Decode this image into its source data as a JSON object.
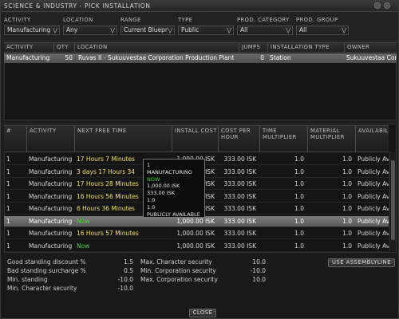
{
  "window": {
    "title": "SCIENCE & INDUSTRY - PICK INSTALLATION"
  },
  "filters": {
    "activity": {
      "label": "ACTIVITY",
      "value": "Manufacturing"
    },
    "location": {
      "label": "LOCATION",
      "value": "Any"
    },
    "range": {
      "label": "RANGE",
      "value": "Current Bluepr"
    },
    "type": {
      "label": "TYPE",
      "value": "Public"
    },
    "prod_category": {
      "label": "PROD. CATEGORY",
      "value": "All"
    },
    "prod_group": {
      "label": "PROD. GROUP",
      "value": "All"
    }
  },
  "locations_table": {
    "headers": [
      "ACTIVITY",
      "QTY",
      "LOCATION",
      "JUMPS",
      "INSTALLATION TYPE",
      "OWNER"
    ],
    "rows": [
      [
        "Manufacturing",
        "50",
        "Ruvas II - Sukuuvestaa Corporation Production Plant",
        "0",
        "Station",
        "Sukuuvestaa Corp"
      ]
    ]
  },
  "lines_table": {
    "headers": [
      "#",
      "ACTIVITY",
      "NEXT FREE TIME",
      "INSTALL COST",
      "COST PER HOUR",
      "TIME MULTIPLIER",
      "MATERIAL MULTIPLIER",
      "AVAILABILITY"
    ],
    "rows": [
      [
        "1",
        "Manufacturing",
        "17 Hours 7 Minutes",
        "1,000.00 ISK",
        "333.00 ISK",
        "1.0",
        "1.0",
        "Publicly Ava"
      ],
      [
        "1",
        "Manufacturing",
        "3 days 17 Hours 34",
        "1,000.00 ISK",
        "333.00 ISK",
        "1.0",
        "1.0",
        "Publicly Ava"
      ],
      [
        "1",
        "Manufacturing",
        "17 Hours 28 Minutes",
        "1,000.00 ISK",
        "333.00 ISK",
        "1.0",
        "1.0",
        "Publicly Ava"
      ],
      [
        "1",
        "Manufacturing",
        "16 Hours 56 Minutes",
        "1,000.00 ISK",
        "333.00 ISK",
        "1.0",
        "1.0",
        "Publicly Ava"
      ],
      [
        "1",
        "Manufacturing",
        "6 Hours 36 Minutes",
        "1,000.00 ISK",
        "333.00 ISK",
        "1.0",
        "1.0",
        "Publicly Ava"
      ],
      [
        "1",
        "Manufacturing",
        "Now",
        "1,000.00 ISK",
        "333.00 ISK",
        "1.0",
        "1.0",
        "Publicly Ava"
      ],
      [
        "1",
        "Manufacturing",
        "16 Hours 57 Minutes",
        "1,000.00 ISK",
        "333.00 ISK",
        "1.0",
        "1.0",
        "Publicly Ava"
      ],
      [
        "1",
        "Manufacturing",
        "Now",
        "1,000.00 ISK",
        "333.00 ISK",
        "1.0",
        "1.0",
        "Publicly Ava"
      ]
    ]
  },
  "tooltip": {
    "lines": [
      "1",
      "MANUFACTURING",
      "NOW",
      "1,000.00 ISK",
      "333.00 ISK",
      "1.0",
      "1.0",
      "PUBLICLY AVAILABLE"
    ]
  },
  "standings_left": [
    {
      "label": "Good standing discount %",
      "value": "1.5"
    },
    {
      "label": "Bad standing surcharge %",
      "value": "0.5"
    },
    {
      "label": "Min. standing",
      "value": "-10.0"
    },
    {
      "label": "Min. Character security",
      "value": "-10.0"
    }
  ],
  "standings_right": [
    {
      "label": "Max. Character security",
      "value": "10.0"
    },
    {
      "label": "Min. Corporation security",
      "value": "-10.0"
    },
    {
      "label": "Max. Corporation security",
      "value": "10.0"
    }
  ],
  "buttons": {
    "use_assembly_line": "USE ASSEMBLYLINE",
    "close": "CLOSE"
  },
  "colors": {
    "highlight_time": "#f0e060",
    "now": "#50d040",
    "selected_row": "#6a6a6a"
  }
}
